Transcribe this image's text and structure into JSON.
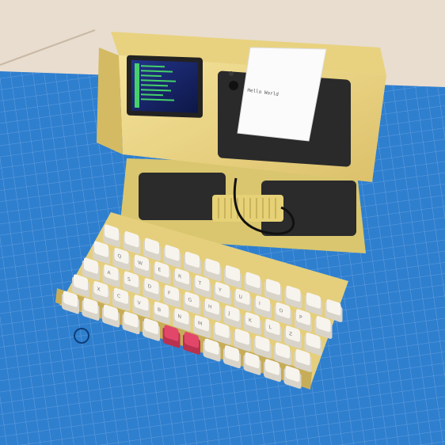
{
  "photo": {
    "printer_paper_text": "Hello World",
    "keycap_legends": [
      "Q",
      "W",
      "E",
      "R",
      "T",
      "Y",
      "U",
      "I",
      "O",
      "P",
      "A",
      "S",
      "D",
      "F",
      "G",
      "H",
      "J",
      "K",
      "L",
      "Z",
      "X",
      "C",
      "V",
      "B",
      "N",
      "M"
    ],
    "colors": {
      "table": "#e9ddcf",
      "cutting_mat": "#2f7fcf",
      "case": "#efdb8f",
      "case_shadow": "#d7c06c",
      "keycap": "#f7f4ee",
      "accent_keycap": "#e2476a",
      "screen": "#1b2a6b",
      "terminal_text": "#45d06a",
      "printer": "#2a2a2a",
      "paper": "#fbfbfb"
    }
  }
}
